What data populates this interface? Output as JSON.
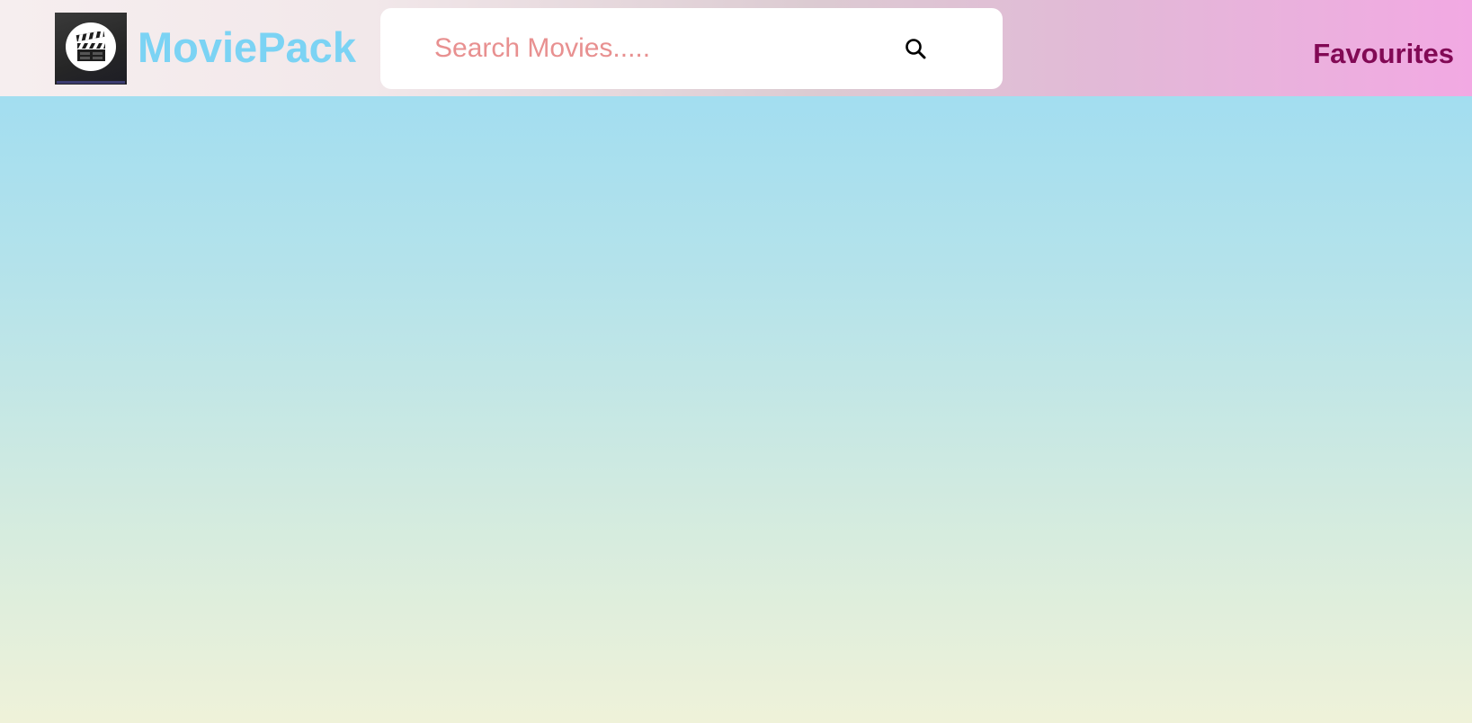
{
  "app": {
    "brand_name": "MoviePack",
    "logo_icon": "clapperboard-icon"
  },
  "search": {
    "placeholder": "Search Movies.....",
    "value": "",
    "icon": "search-icon"
  },
  "nav": {
    "favourites_label": "Favourites"
  },
  "colors": {
    "brand_text": "#7bd3f4",
    "search_placeholder": "#e89090",
    "favourites_text": "#820955",
    "header_gradient_start": "#f6eeef",
    "header_gradient_end": "#f2a9e3",
    "page_gradient_top": "#99dbf3",
    "page_gradient_bottom": "#eff2d9"
  }
}
